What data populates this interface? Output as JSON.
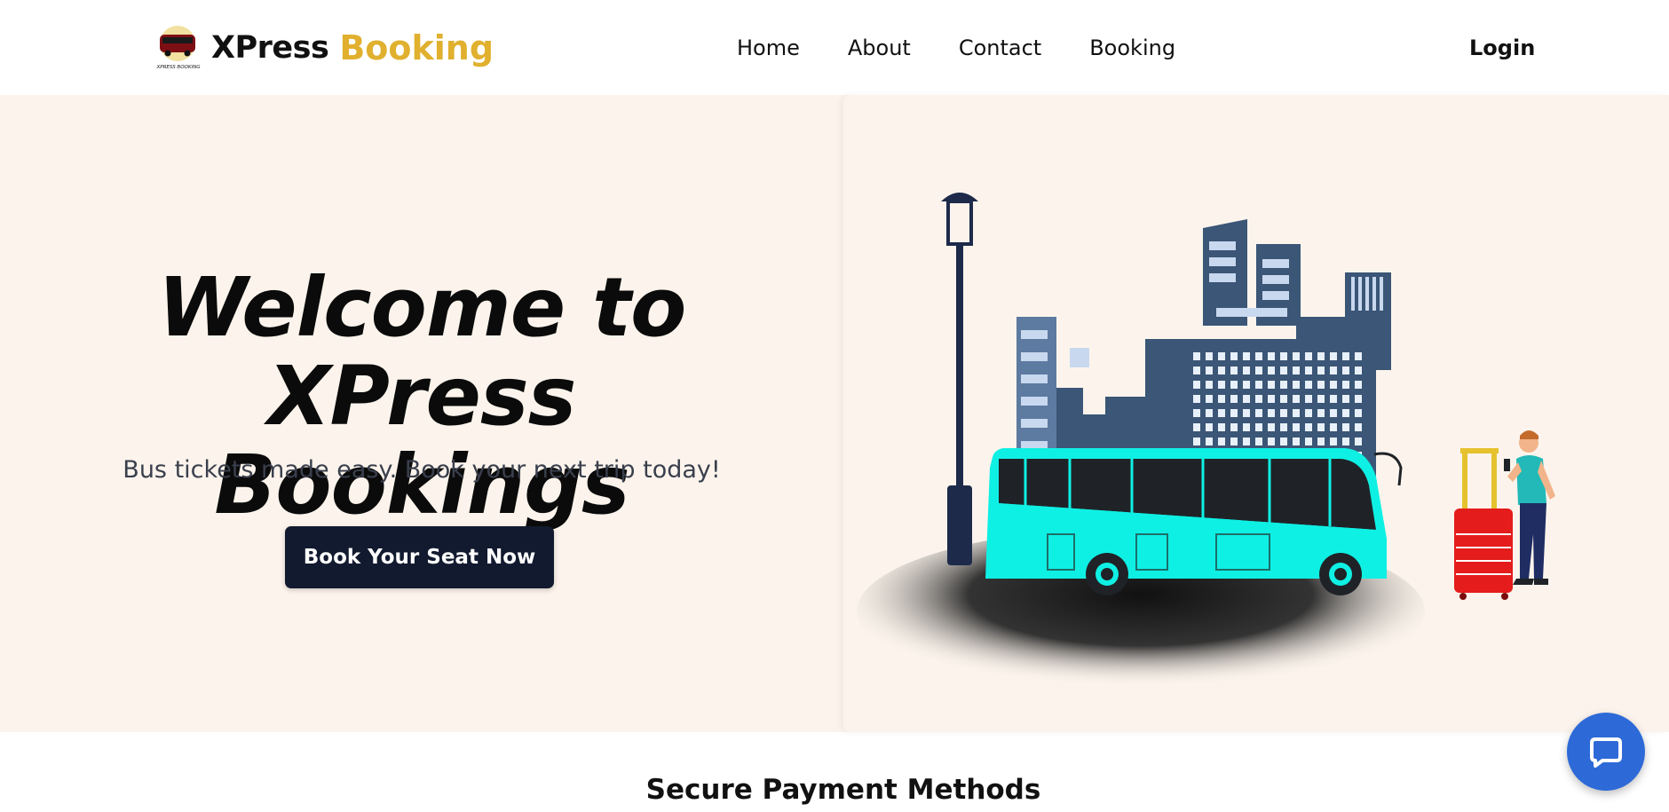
{
  "header": {
    "brand_name": "XPress",
    "brand_accent": "Booking",
    "logo_text": "XPRESS BOOKING",
    "nav": [
      {
        "label": "Home"
      },
      {
        "label": "About"
      },
      {
        "label": "Contact"
      },
      {
        "label": "Booking"
      }
    ],
    "login_label": "Login"
  },
  "hero": {
    "title_line1": "Welcome to XPress",
    "title_line2": "Bookings",
    "subtitle": "Bus tickets made easy. Book your next trip today!",
    "cta_label": "Book Your Seat Now",
    "illustration": "bus-city-traveler-illustration"
  },
  "payment": {
    "title": "Secure Payment Methods"
  },
  "chat": {
    "icon": "chat-bubble-icon"
  },
  "colors": {
    "accent": "#e0b02e",
    "hero_bg": "#fcf4ec",
    "cta_bg": "#121a2f",
    "bus": "#0ff0e4",
    "chat": "#2d6ad8"
  }
}
